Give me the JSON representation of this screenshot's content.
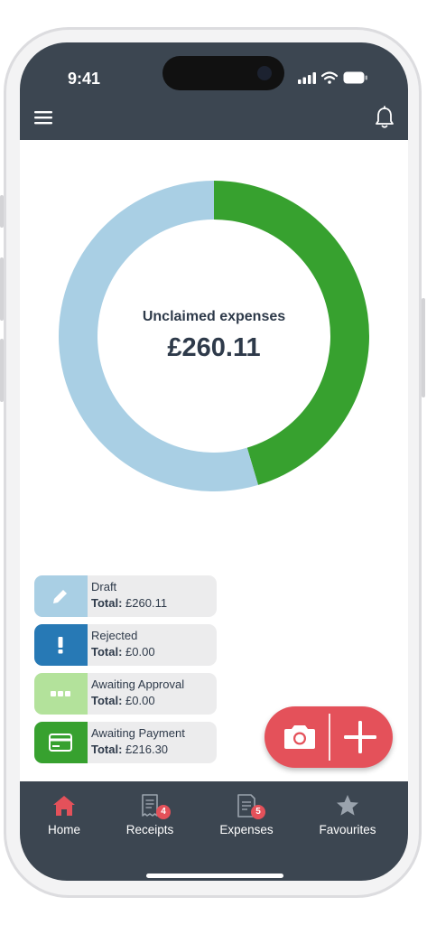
{
  "status_bar": {
    "time": "9:41"
  },
  "chart": {
    "center_label": "Unclaimed expenses",
    "center_amount": "£260.11"
  },
  "chart_data": {
    "type": "pie",
    "categories": [
      "Awaiting Payment",
      "Draft"
    ],
    "values": [
      216.3,
      260.11
    ],
    "colors": [
      "#37a12f",
      "#a9cfe4"
    ]
  },
  "legend": [
    {
      "title": "Draft",
      "total_label": "Total:",
      "total_value": "£260.11",
      "color": "#a9cfe4",
      "icon": "pencil-icon"
    },
    {
      "title": "Rejected",
      "total_label": "Total:",
      "total_value": "£0.00",
      "color": "#2779b5",
      "icon": "exclamation-icon"
    },
    {
      "title": "Awaiting Approval",
      "total_label": "Total:",
      "total_value": "£0.00",
      "color": "#b3e29b",
      "icon": "dots-icon"
    },
    {
      "title": "Awaiting Payment",
      "total_label": "Total:",
      "total_value": "£216.30",
      "color": "#37a12f",
      "icon": "card-icon"
    }
  ],
  "bottom_nav": [
    {
      "label": "Home",
      "icon": "home-icon",
      "active": true
    },
    {
      "label": "Receipts",
      "icon": "receipt-icon",
      "badge": "4"
    },
    {
      "label": "Expenses",
      "icon": "expenses-icon",
      "badge": "5"
    },
    {
      "label": "Favourites",
      "icon": "star-icon"
    }
  ],
  "colors": {
    "header": "#3c4651",
    "accent": "#e4515a"
  }
}
